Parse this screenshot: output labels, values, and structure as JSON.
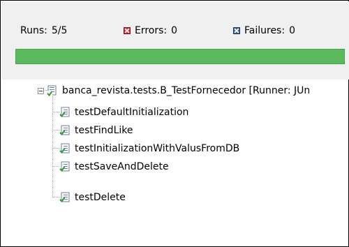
{
  "counters": {
    "runs_label": "Runs:",
    "runs_value": "5/5",
    "errors_label": "Errors:",
    "errors_value": "0",
    "failures_label": "Failures:",
    "failures_value": "0"
  },
  "progress": {
    "fraction": 1.0,
    "color": "#5cb85c"
  },
  "tree": {
    "root": {
      "label": "banca_revista.tests.B_TestFornecedor [Runner: JUn",
      "icon": "test-suite-icon",
      "expanded": true
    },
    "tests": [
      {
        "label": "testDefaultInitialization",
        "icon": "test-passed-icon"
      },
      {
        "label": "testFindLike",
        "icon": "test-passed-icon"
      },
      {
        "label": "testInitializationWithValusFromDB",
        "icon": "test-passed-icon"
      },
      {
        "label": "testSaveAndDelete",
        "icon": "test-passed-icon"
      },
      {
        "label": "testDelete",
        "icon": "test-passed-icon"
      }
    ]
  }
}
